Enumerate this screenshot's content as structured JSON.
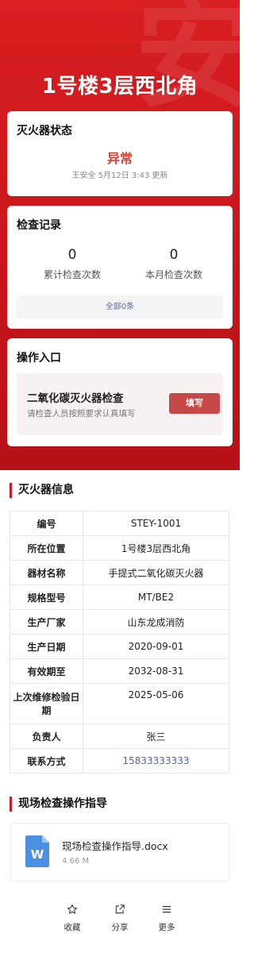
{
  "header": {
    "title": "1号楼3层西北角",
    "watermark": "安"
  },
  "status_card": {
    "title": "灭火器状态",
    "status": "异常",
    "meta": "王安全 5月12日 3:43 更新",
    "status_color": "#d9412f"
  },
  "records": {
    "title": "检查记录",
    "total_count": "0",
    "total_label": "累计检查次数",
    "month_count": "0",
    "month_label": "本月检查次数",
    "all_link": "全部0条"
  },
  "operations": {
    "title": "操作入口",
    "item_name": "二氧化碳灭火器检查",
    "item_desc": "请检查人员按照要求认真填写",
    "fill_button": "填写"
  },
  "info": {
    "title": "灭火器信息",
    "rows": [
      {
        "key": "编号",
        "value": "STEY-1001"
      },
      {
        "key": "所在位置",
        "value": "1号楼3层西北角"
      },
      {
        "key": "器材名称",
        "value": "手提式二氧化碳灭火器"
      },
      {
        "key": "规格型号",
        "value": "MT/BE2"
      },
      {
        "key": "生产厂家",
        "value": "山东龙成消防"
      },
      {
        "key": "生产日期",
        "value": "2020-09-01"
      },
      {
        "key": "有效期至",
        "value": "2032-08-31"
      },
      {
        "key": "上次维修检验日期",
        "value": "2025-05-06"
      },
      {
        "key": "负责人",
        "value": "张三"
      },
      {
        "key": "联系方式",
        "value": "15833333333"
      }
    ]
  },
  "guide": {
    "title": "现场检查操作指导",
    "file_name": "现场检查操作指导.docx",
    "file_size": "4.66 M",
    "file_icon_letter": "W",
    "file_icon": "word-document-icon"
  },
  "bottom_bar": {
    "favorite": "收藏",
    "share": "分享",
    "more": "更多"
  },
  "colors": {
    "brand_red": "#c8161a",
    "accent": "#c81b1f",
    "button": "#c74848",
    "link": "#4a6a96"
  }
}
